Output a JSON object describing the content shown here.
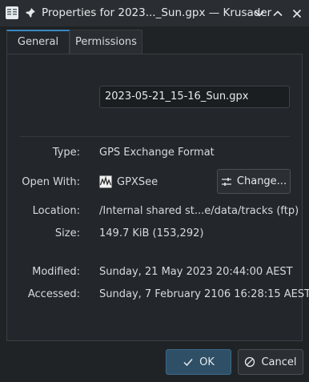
{
  "window": {
    "title": "Properties for 2023..._Sun.gpx — Krusader"
  },
  "tabs": [
    {
      "label": "General",
      "active": true
    },
    {
      "label": "Permissions",
      "active": false
    }
  ],
  "general": {
    "filename": "2023-05-21_15-16_Sun.gpx",
    "type_label": "Type:",
    "type_value": "GPS Exchange Format",
    "open_with_label": "Open With:",
    "open_with_app": "GPXSee",
    "change_label": "Change...",
    "location_label": "Location:",
    "location_value": "/Internal shared st...e/data/tracks (ftp)",
    "size_label": "Size:",
    "size_value": "149.7 KiB (153,292)",
    "modified_label": "Modified:",
    "modified_value": "Sunday, 21 May 2023 20:44:00 AEST",
    "accessed_label": "Accessed:",
    "accessed_value": "Sunday, 7 February 2106 16:28:15 AEST"
  },
  "buttons": {
    "ok": "OK",
    "cancel": "Cancel"
  },
  "icons": {
    "app": "file-manager-icon",
    "pin": "pin-icon",
    "minimize": "chevron-down-icon",
    "maximize": "chevron-up-icon",
    "close": "close-icon",
    "gpxsee": "gpxsee-app-icon",
    "change": "settings-sliders-icon",
    "ok": "checkmark-icon",
    "cancel": "cancel-icon"
  },
  "colors": {
    "accent": "#3a87c4",
    "ok_button": "#2e4f66",
    "background": "#202326"
  }
}
